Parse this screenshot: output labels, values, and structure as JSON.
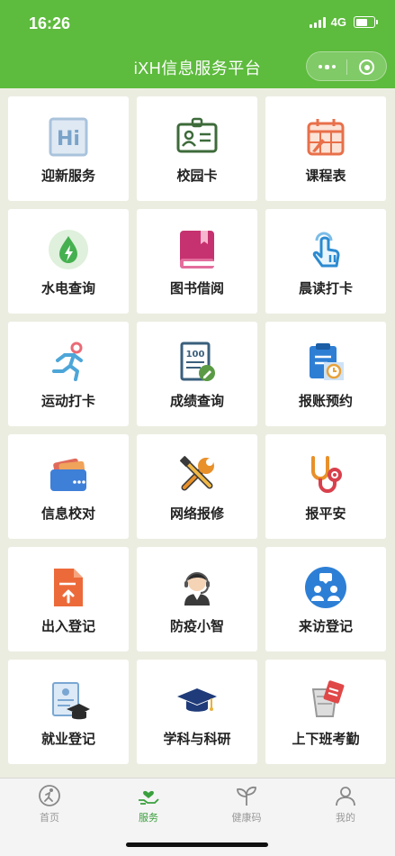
{
  "status_bar": {
    "time": "16:26",
    "network": "4G"
  },
  "header": {
    "title": "iXH信息服务平台"
  },
  "colors": {
    "brand": "#5dbb3d",
    "tab_active": "#3aa03d",
    "tab_inactive": "#999999"
  },
  "grid": {
    "tiles": [
      {
        "label": "迎新服务",
        "icon": "hi-welcome-icon"
      },
      {
        "label": "校园卡",
        "icon": "id-card-icon"
      },
      {
        "label": "课程表",
        "icon": "calendar-icon"
      },
      {
        "label": "水电查询",
        "icon": "water-electricity-icon"
      },
      {
        "label": "图书借阅",
        "icon": "book-icon"
      },
      {
        "label": "晨读打卡",
        "icon": "tap-hand-icon"
      },
      {
        "label": "运动打卡",
        "icon": "running-icon"
      },
      {
        "label": "成绩查询",
        "icon": "score-sheet-icon"
      },
      {
        "label": "报账预约",
        "icon": "clipboard-clock-icon"
      },
      {
        "label": "信息校对",
        "icon": "wallet-icon"
      },
      {
        "label": "网络报修",
        "icon": "tools-icon"
      },
      {
        "label": "报平安",
        "icon": "stethoscope-icon"
      },
      {
        "label": "出入登记",
        "icon": "document-upload-icon"
      },
      {
        "label": "防疫小智",
        "icon": "support-agent-icon"
      },
      {
        "label": "来访登记",
        "icon": "visitor-chat-icon"
      },
      {
        "label": "就业登记",
        "icon": "resume-graduate-icon"
      },
      {
        "label": "学科与科研",
        "icon": "graduation-cap-icon"
      },
      {
        "label": "上下班考勤",
        "icon": "attendance-icon"
      }
    ]
  },
  "tabbar": {
    "tabs": [
      {
        "label": "首页",
        "icon": "home-runner-icon",
        "active": false
      },
      {
        "label": "服务",
        "icon": "service-hand-heart-icon",
        "active": true
      },
      {
        "label": "健康码",
        "icon": "health-sprout-icon",
        "active": false
      },
      {
        "label": "我的",
        "icon": "person-icon",
        "active": false
      }
    ]
  }
}
